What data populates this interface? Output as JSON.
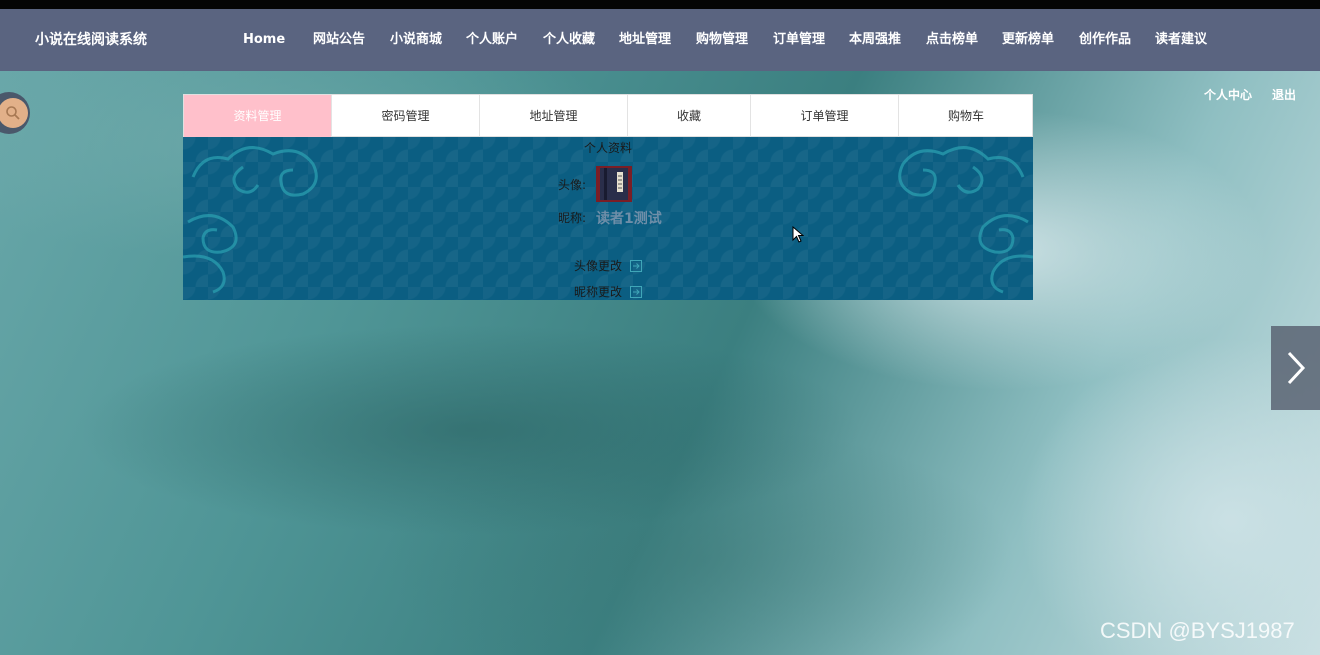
{
  "site": {
    "title": "小说在线阅读系统"
  },
  "nav": [
    {
      "id": "home",
      "label": "Home"
    },
    {
      "id": "notice",
      "label": "网站公告"
    },
    {
      "id": "mall",
      "label": "小说商城"
    },
    {
      "id": "account",
      "label": "个人账户"
    },
    {
      "id": "favorites",
      "label": "个人收藏"
    },
    {
      "id": "address",
      "label": "地址管理"
    },
    {
      "id": "cart",
      "label": "购物管理"
    },
    {
      "id": "orders",
      "label": "订单管理"
    },
    {
      "id": "weekly",
      "label": "本周强推"
    },
    {
      "id": "clicks",
      "label": "点击榜单"
    },
    {
      "id": "updates",
      "label": "更新榜单"
    },
    {
      "id": "works",
      "label": "创作作品"
    },
    {
      "id": "suggest",
      "label": "读者建议"
    }
  ],
  "user_links": {
    "center": "个人中心",
    "logout": "退出"
  },
  "tabs": [
    {
      "label": "资料管理",
      "active": true
    },
    {
      "label": "密码管理",
      "active": false
    },
    {
      "label": "地址管理",
      "active": false
    },
    {
      "label": "收藏",
      "active": false
    },
    {
      "label": "订单管理",
      "active": false
    },
    {
      "label": "购物车",
      "active": false
    }
  ],
  "profile": {
    "section_title": "个人资料",
    "avatar_label": "头像:",
    "nickname_label": "昵称:",
    "nickname_value": "读者1测试",
    "change_avatar": "头像更改",
    "change_nickname": "昵称更改"
  },
  "colors": {
    "navbar": "#5a6480",
    "active_tab": "#ffc0cb",
    "content_bg": "#0b5e82"
  },
  "watermark": "CSDN @BYSJ1987"
}
